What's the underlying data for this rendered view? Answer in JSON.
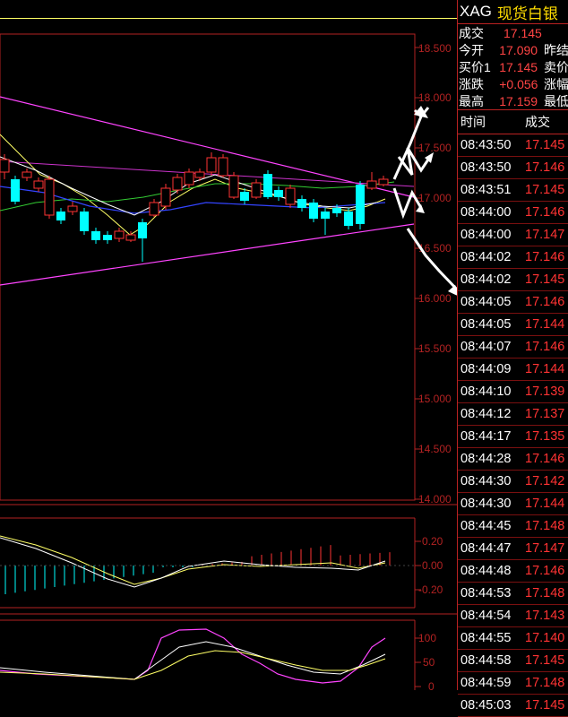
{
  "symbol": "XAG",
  "name": "现货白银",
  "quote": [
    {
      "label": "成交",
      "value": "17.145",
      "label2": ""
    },
    {
      "label": "今开",
      "value": "17.090",
      "label2": "昨结"
    },
    {
      "label": "买价1",
      "value": "17.145",
      "label2": "卖价"
    },
    {
      "label": "涨跌",
      "value": "+0.056",
      "label2": "涨幅"
    },
    {
      "label": "最高",
      "value": "17.159",
      "label2": "最低"
    }
  ],
  "trades_header": {
    "time": "时间",
    "price": "成交"
  },
  "trades": [
    {
      "time": "08:43:50",
      "price": "17.145"
    },
    {
      "time": "08:43:50",
      "price": "17.146"
    },
    {
      "time": "08:43:51",
      "price": "17.145"
    },
    {
      "time": "08:44:00",
      "price": "17.146"
    },
    {
      "time": "08:44:00",
      "price": "17.147"
    },
    {
      "time": "08:44:02",
      "price": "17.146"
    },
    {
      "time": "08:44:02",
      "price": "17.145"
    },
    {
      "time": "08:44:05",
      "price": "17.146"
    },
    {
      "time": "08:44:05",
      "price": "17.144"
    },
    {
      "time": "08:44:07",
      "price": "17.146"
    },
    {
      "time": "08:44:09",
      "price": "17.144"
    },
    {
      "time": "08:44:10",
      "price": "17.139"
    },
    {
      "time": "08:44:12",
      "price": "17.137"
    },
    {
      "time": "08:44:17",
      "price": "17.135"
    },
    {
      "time": "08:44:28",
      "price": "17.146"
    },
    {
      "time": "08:44:30",
      "price": "17.142"
    },
    {
      "time": "08:44:30",
      "price": "17.144"
    },
    {
      "time": "08:44:45",
      "price": "17.148"
    },
    {
      "time": "08:44:47",
      "price": "17.147"
    },
    {
      "time": "08:44:48",
      "price": "17.146"
    },
    {
      "time": "08:44:53",
      "price": "17.148"
    },
    {
      "time": "08:44:54",
      "price": "17.143"
    },
    {
      "time": "08:44:55",
      "price": "17.140"
    },
    {
      "time": "08:44:58",
      "price": "17.145"
    },
    {
      "time": "08:44:59",
      "price": "17.148"
    },
    {
      "time": "08:45:03",
      "price": "17.145"
    }
  ],
  "price_axis": [
    "18.500",
    "18.000",
    "17.500",
    "17.000",
    "16.500",
    "16.000",
    "15.500",
    "15.000",
    "14.500",
    "14.000"
  ],
  "macd_axis": [
    "0.20",
    "0.00",
    "-0.20"
  ],
  "kdj_axis": [
    "100",
    "50",
    "0"
  ],
  "colors": {
    "up": "#ff3333",
    "down": "#00ffff",
    "grid": "#b22222",
    "name": "#ffdd00"
  }
}
